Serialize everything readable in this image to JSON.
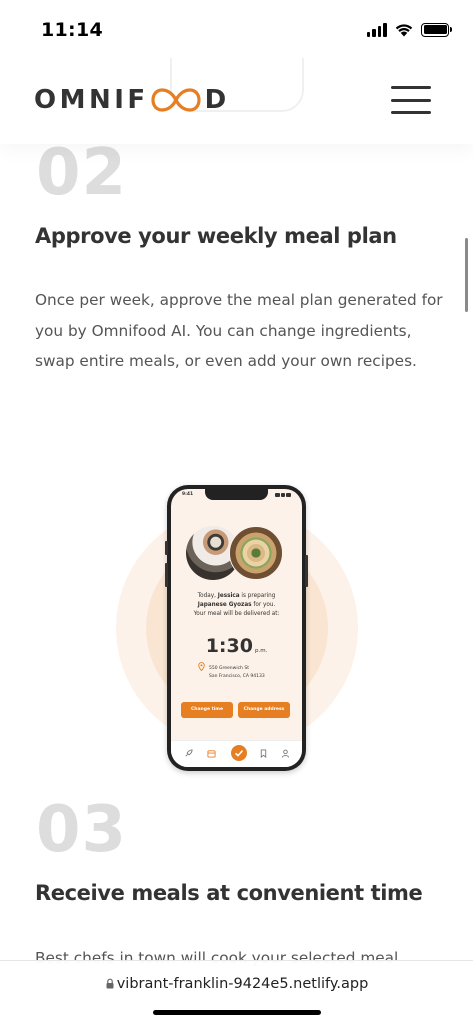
{
  "status_bar": {
    "time": "11:14"
  },
  "header": {
    "logo_left": "OMNIF",
    "logo_right": "D",
    "logo_loop_text": "OO"
  },
  "steps": [
    {
      "number": "02",
      "title": "Approve your weekly meal plan",
      "description": "Once per week, approve the meal plan generated for you by Omnifood AI. You can change ingredients, swap entire meals, or even add your own recipes."
    },
    {
      "number": "03",
      "title": "Receive meals at convenient time",
      "description": "Best chefs in town will cook your selected meal"
    }
  ],
  "phone_app": {
    "time": "9:41",
    "line1_prefix": "Today, ",
    "line1_name": "Jessica",
    "line1_suffix": " is preparing",
    "line2_dish": "Japanese Gyozas",
    "line2_suffix": " for you.",
    "line3": "Your meal will be delivered at:",
    "delivery_time": "1:30",
    "delivery_ampm": "p.m.",
    "address_line1": "550 Greenwich St",
    "address_line2": "San Francisco, CA 94133",
    "change_time_label": "Change time",
    "change_address_label": "Change address"
  },
  "browser": {
    "url": "vibrant-franklin-9424e5.netlify.app"
  },
  "colors": {
    "brand": "#e67e22",
    "brand_tint_light": "#fdf2e9",
    "brand_tint_medium": "#fae5d3",
    "text_dark": "#333333",
    "step_number": "#dddddd"
  }
}
